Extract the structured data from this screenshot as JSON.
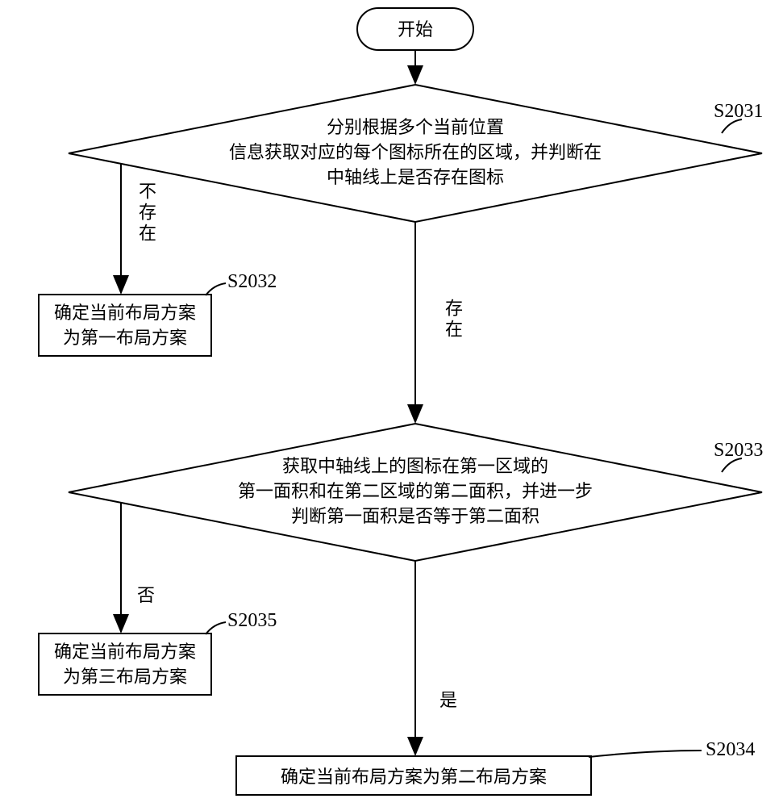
{
  "start": {
    "text": "开始"
  },
  "decision1": {
    "text": "分别根据多个当前位置\n信息获取对应的每个图标所在的区域，并判断在\n中轴线上是否存在图标",
    "step": "S2031",
    "no_label": "不存在",
    "yes_label": "存在"
  },
  "process1": {
    "text": "确定当前布局方案\n为第一布局方案",
    "step": "S2032"
  },
  "decision2": {
    "text": "获取中轴线上的图标在第一区域的\n第一面积和在第二区域的第二面积，并进一步\n判断第一面积是否等于第二面积",
    "step": "S2033",
    "no_label": "否",
    "yes_label": "是"
  },
  "process2": {
    "text": "确定当前布局方案\n为第三布局方案",
    "step": "S2035"
  },
  "process3": {
    "text": "确定当前布局方案为第二布局方案",
    "step": "S2034"
  }
}
